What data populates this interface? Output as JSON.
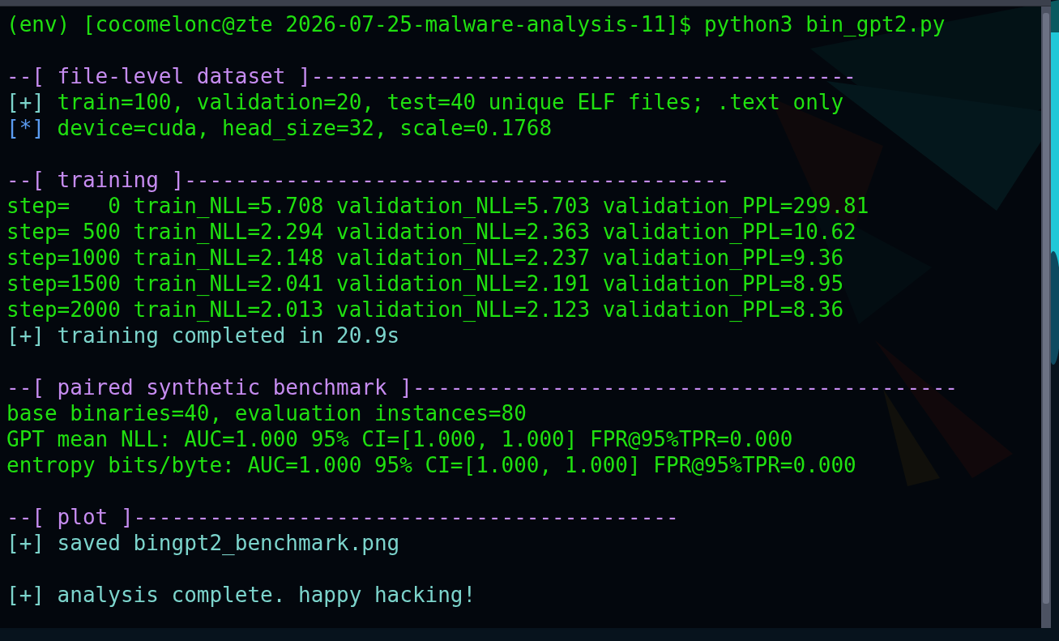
{
  "terminal": {
    "lines": [
      {
        "kind": "text",
        "segments": [
          {
            "kind": "output",
            "text": "(env) [cocomelonc@zte 2026-07-25-malware-analysis-11]$ python3 bin_gpt2.py"
          }
        ]
      },
      {
        "kind": "blank"
      },
      {
        "kind": "text",
        "segments": [
          {
            "kind": "heading",
            "text": "--[ file-level dataset ]-------------------------------------------"
          }
        ]
      },
      {
        "kind": "text",
        "segments": [
          {
            "kind": "plus",
            "text": "[+]"
          },
          {
            "kind": "output",
            "text": " train=100, validation=20, test=40 unique ELF files; .text only"
          }
        ]
      },
      {
        "kind": "text",
        "segments": [
          {
            "kind": "star",
            "text": "[*]"
          },
          {
            "kind": "output",
            "text": " device=cuda, head_size=32, scale=0.1768"
          }
        ]
      },
      {
        "kind": "blank"
      },
      {
        "kind": "text",
        "segments": [
          {
            "kind": "heading",
            "text": "--[ training ]-------------------------------------------"
          }
        ]
      },
      {
        "kind": "text",
        "segments": [
          {
            "kind": "output",
            "text": "step=   0 train_NLL=5.708 validation_NLL=5.703 validation_PPL=299.81"
          }
        ]
      },
      {
        "kind": "text",
        "segments": [
          {
            "kind": "output",
            "text": "step= 500 train_NLL=2.294 validation_NLL=2.363 validation_PPL=10.62"
          }
        ]
      },
      {
        "kind": "text",
        "segments": [
          {
            "kind": "output",
            "text": "step=1000 train_NLL=2.148 validation_NLL=2.237 validation_PPL=9.36"
          }
        ]
      },
      {
        "kind": "text",
        "segments": [
          {
            "kind": "output",
            "text": "step=1500 train_NLL=2.041 validation_NLL=2.191 validation_PPL=8.95"
          }
        ]
      },
      {
        "kind": "text",
        "segments": [
          {
            "kind": "output",
            "text": "step=2000 train_NLL=2.013 validation_NLL=2.123 validation_PPL=8.36"
          }
        ]
      },
      {
        "kind": "text",
        "segments": [
          {
            "kind": "note",
            "text": "[+] training completed in 20.9s"
          }
        ]
      },
      {
        "kind": "blank"
      },
      {
        "kind": "text",
        "segments": [
          {
            "kind": "heading",
            "text": "--[ paired synthetic benchmark ]-------------------------------------------"
          }
        ]
      },
      {
        "kind": "text",
        "segments": [
          {
            "kind": "output",
            "text": "base binaries=40, evaluation instances=80"
          }
        ]
      },
      {
        "kind": "text",
        "segments": [
          {
            "kind": "output",
            "text": "GPT mean NLL: AUC=1.000 95% CI=[1.000, 1.000] FPR@95%TPR=0.000"
          }
        ]
      },
      {
        "kind": "text",
        "segments": [
          {
            "kind": "output",
            "text": "entropy bits/byte: AUC=1.000 95% CI=[1.000, 1.000] FPR@95%TPR=0.000"
          }
        ]
      },
      {
        "kind": "blank"
      },
      {
        "kind": "text",
        "segments": [
          {
            "kind": "heading",
            "text": "--[ plot ]-------------------------------------------"
          }
        ]
      },
      {
        "kind": "text",
        "segments": [
          {
            "kind": "note",
            "text": "[+] saved bingpt2_benchmark.png"
          }
        ]
      },
      {
        "kind": "blank"
      },
      {
        "kind": "text",
        "segments": [
          {
            "kind": "note",
            "text": "[+] analysis complete. happy hacking!"
          }
        ]
      }
    ]
  }
}
